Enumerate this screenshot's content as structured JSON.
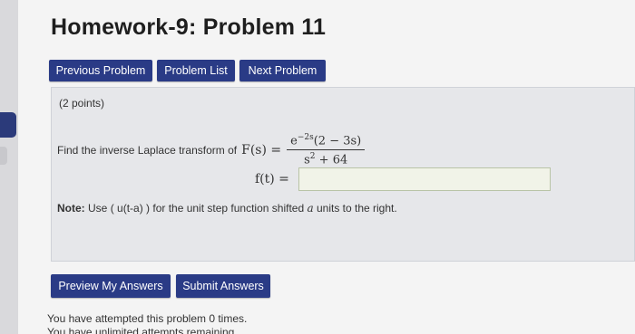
{
  "page": {
    "title": "Homework-9: Problem 11"
  },
  "nav": {
    "previous_label": "Previous Problem",
    "list_label": "Problem List",
    "next_label": "Next Problem"
  },
  "problem": {
    "points": "(2 points)",
    "prompt": "Find the inverse Laplace transform of",
    "function_lhs": "F(s) =",
    "numerator_base": "e",
    "numerator_exp": "−2s",
    "numerator_rest": "(2 − 3s)",
    "denominator_base": "s",
    "denominator_exp": "2",
    "denominator_rest": " + 64",
    "answer_label": "f(t) =",
    "answer_value": "",
    "note_bold": "Note:",
    "note_text_1": "Use ( u(t-a) ) for the unit step function shifted",
    "note_var": "a",
    "note_text_2": "units to the right."
  },
  "actions": {
    "preview_label": "Preview My Answers",
    "submit_label": "Submit Answers"
  },
  "status": {
    "attempts": "You have attempted this problem 0 times.",
    "remaining": "You have unlimited attempts remaining."
  },
  "colors": {
    "button_bg": "#2a3b86",
    "problem_bg": "#e6e7ea",
    "answer_bg": "#f1f3e8"
  }
}
